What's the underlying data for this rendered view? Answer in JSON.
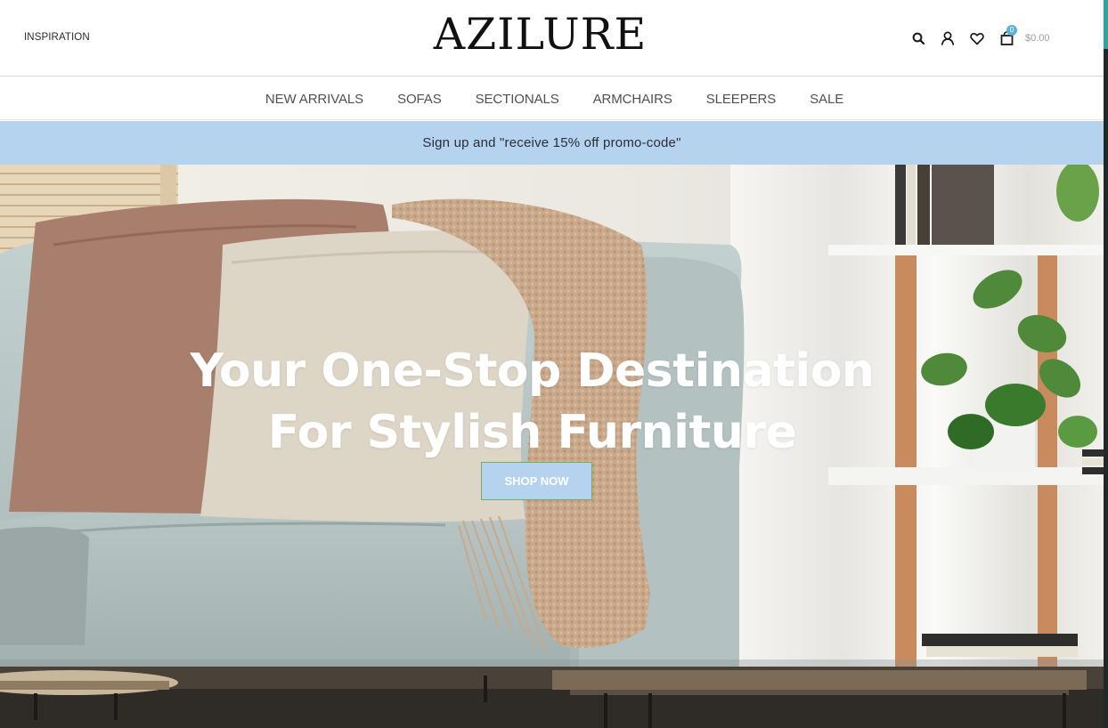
{
  "header": {
    "inspiration_label": "INSPIRATION",
    "logo_text": "AZILURE",
    "cart": {
      "count": "0",
      "total": "$0.00"
    }
  },
  "icons": [
    "search-icon",
    "user-icon",
    "heart-icon",
    "shopping-bag-icon"
  ],
  "nav": {
    "items": [
      {
        "label": "NEW ARRIVALS"
      },
      {
        "label": "SOFAS"
      },
      {
        "label": "SECTIONALS"
      },
      {
        "label": "ARMCHAIRS"
      },
      {
        "label": "SLEEPERS"
      },
      {
        "label": "SALE"
      }
    ]
  },
  "promo": {
    "text": "Sign up and \"receive 15% off promo-code\""
  },
  "hero": {
    "title_line1": "Your One-Stop Destination",
    "title_line2": "For Stylish Furniture",
    "cta_label": "SHOP NOW"
  },
  "colors": {
    "promo_bg": "#b5d2ef",
    "cart_badge": "#5db2d8",
    "cta_border": "#6fb05f",
    "sofa": "#b9c7c7"
  }
}
